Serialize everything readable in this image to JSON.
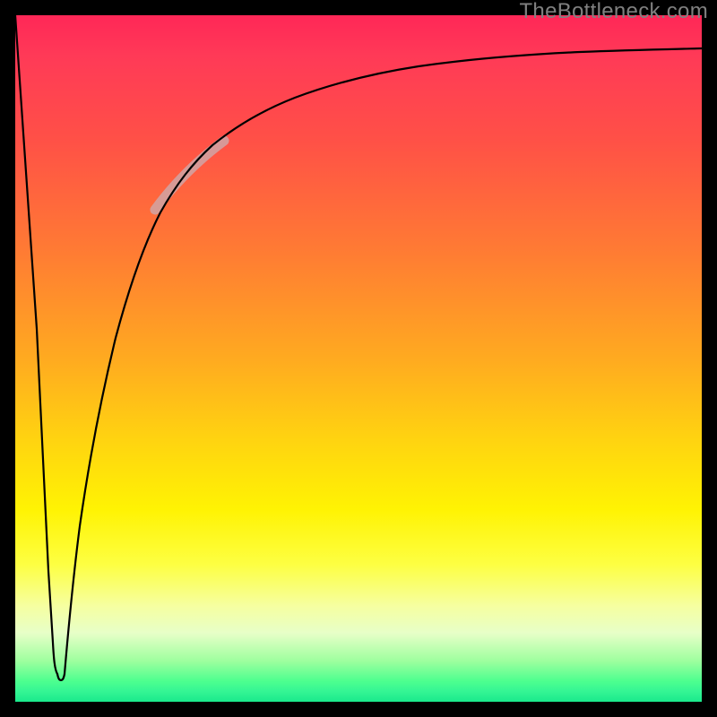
{
  "watermark": {
    "text": "TheBottleneck.com"
  },
  "chart_data": {
    "type": "line",
    "title": "",
    "xlabel": "",
    "ylabel": "",
    "xlim": [
      0,
      100
    ],
    "ylim": [
      0,
      100
    ],
    "grid": false,
    "legend": false,
    "background_gradient": {
      "direction": "vertical",
      "stops": [
        {
          "pos": 0.0,
          "color": "#ff2757"
        },
        {
          "pos": 0.34,
          "color": "#ff7a34"
        },
        {
          "pos": 0.62,
          "color": "#ffd410"
        },
        {
          "pos": 0.8,
          "color": "#fdff42"
        },
        {
          "pos": 0.92,
          "color": "#c0ffb0"
        },
        {
          "pos": 1.0,
          "color": "#1ae98c"
        }
      ]
    },
    "series": [
      {
        "name": "left-spike",
        "x": [
          0.0,
          4.0,
          5.4,
          6.8
        ],
        "y": [
          100.0,
          48.0,
          9.0,
          4.0
        ]
      },
      {
        "name": "main-curve",
        "x": [
          6.8,
          8.2,
          10.0,
          12.4,
          15.0,
          18.0,
          22.0,
          27.0,
          33.0,
          40.0,
          48.0,
          57.0,
          66.0,
          75.0,
          84.0,
          92.0,
          100.0
        ],
        "y": [
          4.0,
          20.0,
          40.0,
          55.0,
          65.0,
          72.0,
          77.5,
          82.0,
          85.5,
          88.0,
          90.0,
          91.5,
          92.6,
          93.4,
          94.0,
          94.4,
          94.8
        ]
      }
    ],
    "highlight_segment": {
      "description": "lighter thicker stroke over part of main curve",
      "x_range": [
        21,
        30
      ],
      "color": "#d0a4a6",
      "width": 11
    },
    "notch": {
      "description": "rounded U join at bottom of spike",
      "x": 6.0,
      "y": 4.0
    }
  }
}
